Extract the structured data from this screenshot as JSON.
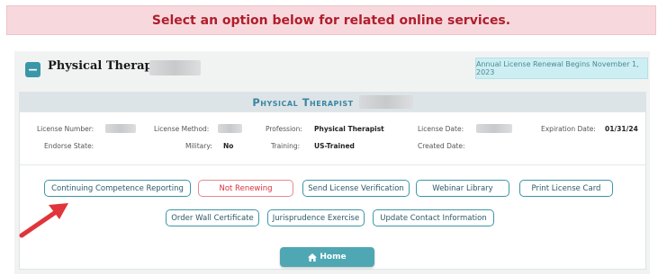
{
  "banner": {
    "text": "Select an option below for related online services."
  },
  "section": {
    "title": "Physical Therapist",
    "renewal_notice": "Annual License Renewal Begins November 1, 2023"
  },
  "license_card": {
    "title": "Physical Therapist",
    "fields": {
      "license_number_label": "License Number:",
      "license_method_label": "License Method:",
      "profession_label": "Profession:",
      "profession_value": "Physical Therapist",
      "license_date_label": "License Date:",
      "expiration_date_label": "Expiration Date:",
      "expiration_date_value": "01/31/24",
      "endorse_state_label": "Endorse State:",
      "military_label": "Military:",
      "military_value": "No",
      "training_label": "Training:",
      "training_value": "US-Trained",
      "created_date_label": "Created Date:"
    }
  },
  "actions": {
    "row1": [
      "Continuing Competence Reporting",
      "Not Renewing",
      "Send License Verification",
      "Webinar Library",
      "Print License Card"
    ],
    "row2": [
      "Order Wall Certificate",
      "Jurisprudence Exercise",
      "Update Contact Information"
    ]
  },
  "home_button": {
    "label": "Home",
    "icon": "home-icon"
  },
  "colors": {
    "accent": "#3b97a8",
    "banner_text": "#b01e2c",
    "not_renewing": "#d9323a",
    "arrow": "#e0353a"
  }
}
